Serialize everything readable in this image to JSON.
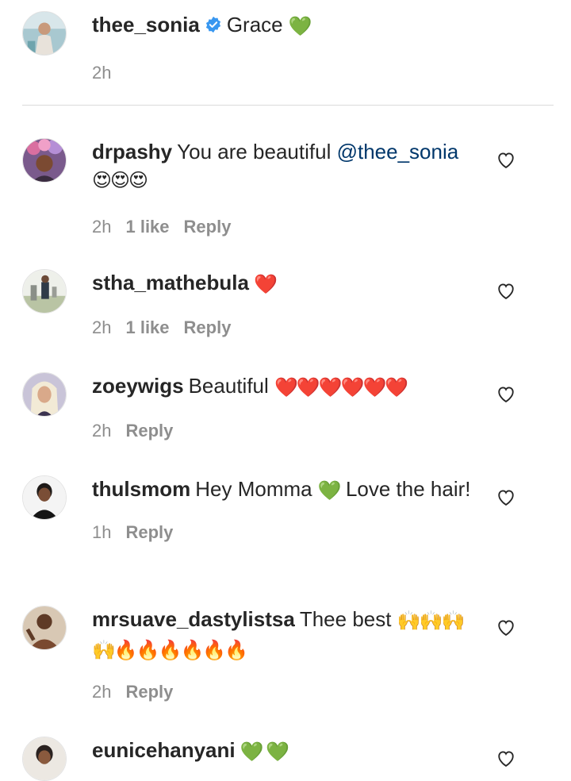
{
  "caption": {
    "username": "thee_sonia",
    "verified": true,
    "text": "Grace",
    "emoji": "💚",
    "time": "2h"
  },
  "comments": [
    {
      "username": "drpashy",
      "text": "You are beautiful",
      "mention": "@thee_sonia",
      "emoji": "😍😍😍",
      "time": "2h",
      "likes": "1 like",
      "reply": "Reply"
    },
    {
      "username": "stha_mathebula",
      "text": "",
      "emoji": "❤️",
      "time": "2h",
      "likes": "1 like",
      "reply": "Reply"
    },
    {
      "username": "zoeywigs",
      "text": "Beautiful",
      "emoji": "❤️❤️❤️❤️❤️❤️",
      "time": "2h",
      "reply": "Reply"
    },
    {
      "username": "thulsmom",
      "text_before": "Hey Momma",
      "emoji": "💚",
      "text_after": "Love the hair!",
      "time": "1h",
      "reply": "Reply"
    },
    {
      "username": "mrsuave_dastylistsa",
      "text": "Thee best",
      "emoji": "🙌🙌🙌🙌🔥🔥🔥🔥🔥🔥",
      "time": "2h",
      "reply": "Reply"
    },
    {
      "username": "eunicehanyani",
      "text": "",
      "emoji": "💚 💚"
    }
  ],
  "icons": {
    "like": "heart-outline-icon",
    "verified": "verified-badge-icon"
  },
  "colors": {
    "text": "#262626",
    "secondary": "#8e8e8e",
    "mention": "#00376b",
    "verified": "#3897f0",
    "divider": "#dbdbdb"
  }
}
